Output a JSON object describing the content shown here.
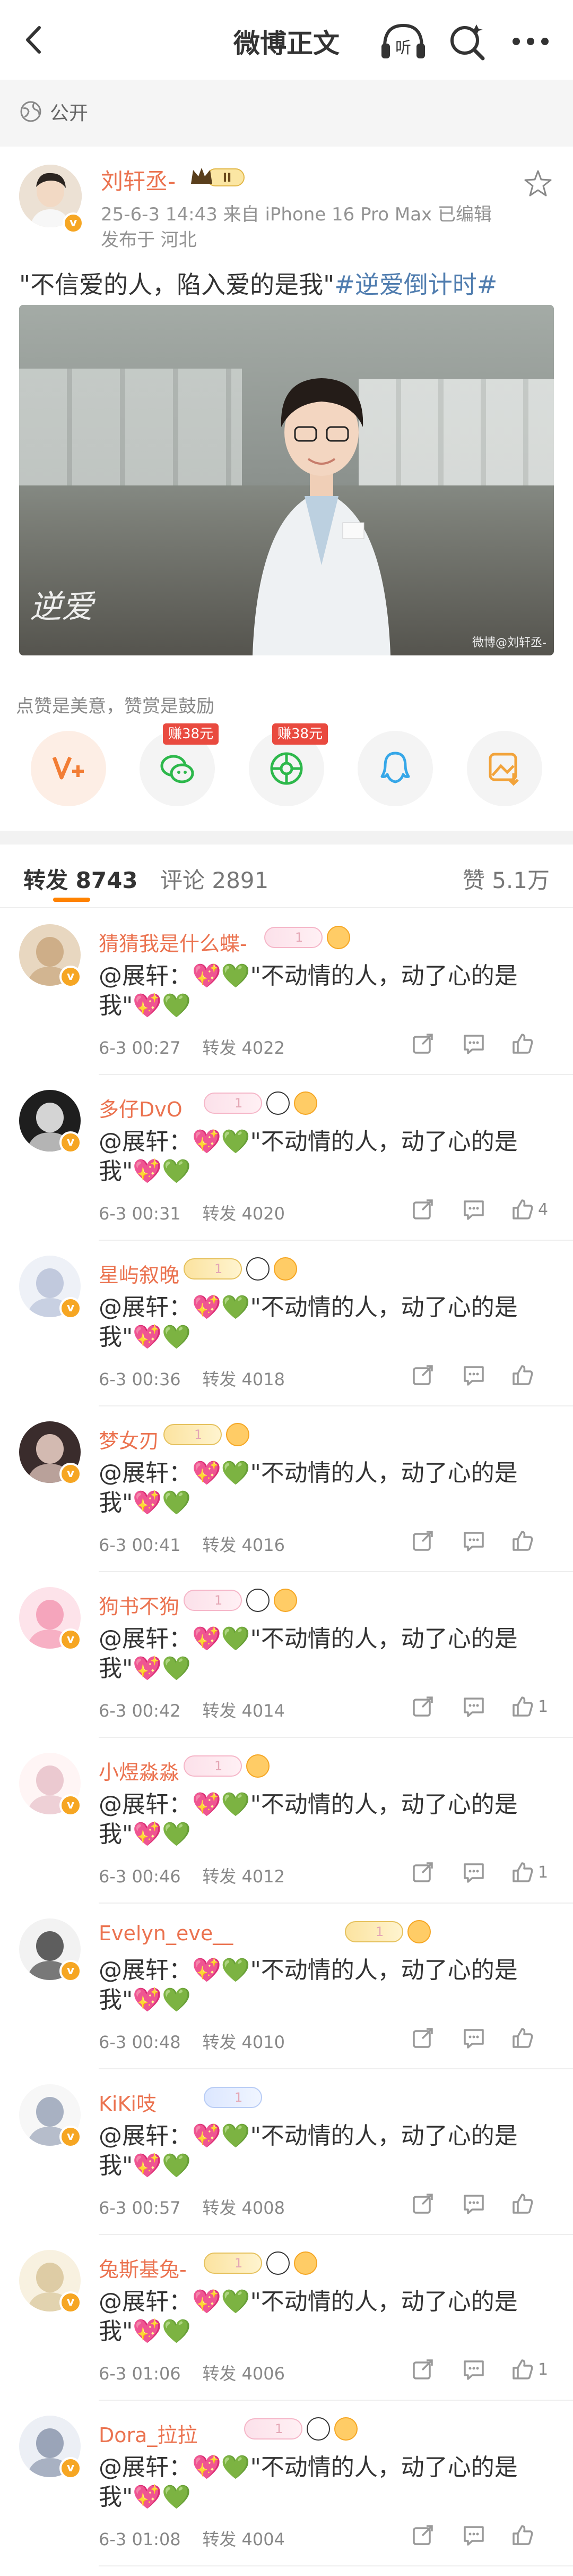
{
  "nav": {
    "title": "微博正文",
    "listen_label": "听"
  },
  "visibility": {
    "label": "公开"
  },
  "post": {
    "author": "刘轩丞-",
    "crown_level": "II",
    "date": "25-6-3 14:43",
    "source": "来自 iPhone 16 Pro Max",
    "edited": "已编辑",
    "location": "发布于 河北",
    "text": "\"不信爱的人，陷入爱的是我\"",
    "hashtag": "#逆爱倒计时#",
    "image": {
      "caption": "逆爱",
      "watermark": "微博@刘轩丞-"
    },
    "reward_text": "点赞是美意，赞赏是鼓励",
    "reward_buttons": [
      {
        "icon": "v-plus-icon",
        "tag": ""
      },
      {
        "icon": "wechat-icon",
        "tag": "赚38元"
      },
      {
        "icon": "moments-icon",
        "tag": "赚38元"
      },
      {
        "icon": "qq-icon",
        "tag": ""
      },
      {
        "icon": "save-image-icon",
        "tag": ""
      }
    ]
  },
  "tabs": {
    "repost": "转发 8743",
    "comment": "评论 2891",
    "like": "赞 5.1万"
  },
  "colors": {
    "accent": "#ff8200",
    "username": "#eb7350",
    "hashtag": "#507daf",
    "earn_tag": "#e94a3f"
  },
  "reposts": [
    {
      "name": "猜猜我是什么蝶-",
      "text": "@展轩：💖💚\"不动情的人，动了心的是我\"💖💚",
      "date": "6-3 00:27",
      "reposts": "转发 4022",
      "likes": "",
      "badges": [
        "level",
        "circle"
      ]
    },
    {
      "name": "多仔DvO",
      "text": "@展轩：💖💚\"不动情的人，动了心的是我\"💖💚",
      "date": "6-3 00:31",
      "reposts": "转发 4020",
      "likes": "4",
      "badges": [
        "level",
        "panda",
        "circle"
      ]
    },
    {
      "name": "星屿叙晚",
      "text": "@展轩：💖💚\"不动情的人，动了心的是我\"💖💚",
      "date": "6-3 00:36",
      "reposts": "转发 4018",
      "likes": "",
      "badges": [
        "gold",
        "panda",
        "circle"
      ]
    },
    {
      "name": "梦女刃",
      "text": "@展轩：💖💚\"不动情的人，动了心的是我\"💖💚",
      "date": "6-3 00:41",
      "reposts": "转发 4016",
      "likes": "",
      "badges": [
        "gold",
        "circle"
      ]
    },
    {
      "name": "狗书不狗",
      "text": "@展轩：💖💚\"不动情的人，动了心的是我\"💖💚",
      "date": "6-3 00:42",
      "reposts": "转发 4014",
      "likes": "1",
      "badges": [
        "level",
        "panda",
        "circle"
      ]
    },
    {
      "name": "小煜淼淼",
      "text": "@展轩：💖💚\"不动情的人，动了心的是我\"💖💚",
      "date": "6-3 00:46",
      "reposts": "转发 4012",
      "likes": "1",
      "badges": [
        "level",
        "circle"
      ]
    },
    {
      "name": "Evelyn_eve__",
      "text": "@展轩：💖💚\"不动情的人，动了心的是我\"💖💚",
      "date": "6-3 00:48",
      "reposts": "转发 4010",
      "likes": "",
      "badges": [
        "gold",
        "circle"
      ]
    },
    {
      "name": "KiKi吱",
      "text": "@展轩：💖💚\"不动情的人，动了心的是我\"💖💚",
      "date": "6-3 00:57",
      "reposts": "转发 4008",
      "likes": "",
      "badges": [
        "blue"
      ]
    },
    {
      "name": "兔斯基兔-",
      "text": "@展轩：💖💚\"不动情的人，动了心的是我\"💖💚",
      "date": "6-3 01:06",
      "reposts": "转发 4006",
      "likes": "1",
      "badges": [
        "gold",
        "panda",
        "circle"
      ]
    },
    {
      "name": "Dora_拉拉",
      "text": "@展轩：💖💚\"不动情的人，动了心的是我\"💖💚",
      "date": "6-3 01:08",
      "reposts": "转发 4004",
      "likes": "",
      "badges": [
        "level",
        "panda",
        "circle"
      ]
    }
  ]
}
